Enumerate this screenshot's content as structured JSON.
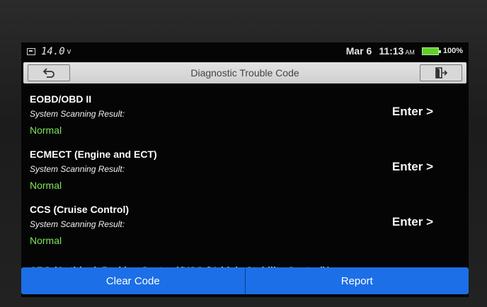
{
  "statusbar": {
    "voltage": "14.0",
    "voltage_unit": "v",
    "date": "Mar 6",
    "time": "11:13",
    "ampm": "AM",
    "battery": "100%"
  },
  "titlebar": {
    "title": "Diagnostic Trouble Code",
    "back_icon": "back-arrow-icon",
    "exit_icon": "exit-door-icon"
  },
  "systems": [
    {
      "name": "EOBD/OBD II",
      "sub": "System Scanning Result:",
      "status": "Normal",
      "enter": "Enter >"
    },
    {
      "name": "ECMECT (Engine and ECT)",
      "sub": "System Scanning Result:",
      "status": "Normal",
      "enter": "Enter >"
    },
    {
      "name": "CCS (Cruise Control)",
      "sub": "System Scanning Result:",
      "status": "Normal",
      "enter": "Enter >"
    }
  ],
  "partial_item": "ABS (Anti-lock Braking System)/VSC (Vehicle Stability Control)/",
  "bottom": {
    "clear_label": "Clear Code",
    "report_label": "Report"
  },
  "colors": {
    "status_ok": "#7ee35a",
    "button_blue": "#1c6fe6",
    "battery": "#5ed12a"
  }
}
